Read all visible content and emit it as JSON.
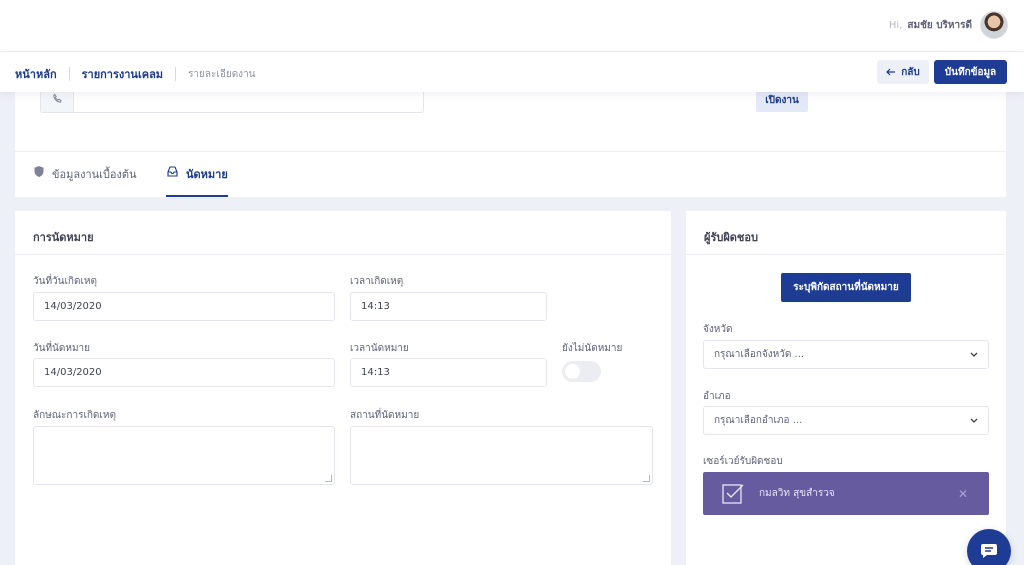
{
  "topbar": {
    "greeting": "Hi,",
    "username": "สมชัย บริหารดี"
  },
  "breadcrumb": {
    "home": "หน้าหลัก",
    "list": "รายการงานเคลม",
    "current": "รายละเอียดงาน"
  },
  "actions": {
    "back_label": "กลับ",
    "save_label": "บันทึกข้อมูล",
    "open_label": "เปิดงาน"
  },
  "tabs": [
    {
      "label": "ข้อมูลงานเบื้องต้น"
    },
    {
      "label": "นัดหมาย"
    }
  ],
  "appointment": {
    "title": "การนัดหมาย",
    "incident_date_label": "วันที่วันเกิดเหตุ",
    "incident_date": "14/03/2020",
    "incident_time_label": "เวลาเกิดเหตุ",
    "incident_time": "14:13",
    "appointment_date_label": "วันที่นัดหมาย",
    "appointment_date": "14/03/2020",
    "appointment_time_label": "เวลานัดหมาย",
    "appointment_time": "14:13",
    "not_scheduled_label": "ยังไม่นัดหมาย",
    "nature_label": "ลักษณะการเกิดเหตุ",
    "place_label": "สถานที่นัดหมาย"
  },
  "responsible": {
    "title": "ผู้รับผิดชอบ",
    "pin_button": "ระบุพิกัดสถานที่นัดหมาย",
    "province_label": "จังหวัด",
    "province_placeholder": "กรุณาเลือกจังหวัด ...",
    "district_label": "อำเภอ",
    "district_placeholder": "กรุณาเลือกอำเภอ ...",
    "surveyor_label": "เซอร์เวย์รับผิดชอบ",
    "surveyor_name": "กมลวิท สุขสำรวจ"
  },
  "colors": {
    "primary": "#1f3c94",
    "assignee_bg": "#675b9f",
    "page_bg": "#eef0f8"
  },
  "icons": [
    "phone-icon",
    "shield-icon",
    "inbox-icon",
    "arrow-left-icon",
    "chevron-down-icon",
    "checkbox-icon",
    "close-icon",
    "chat-icon"
  ]
}
